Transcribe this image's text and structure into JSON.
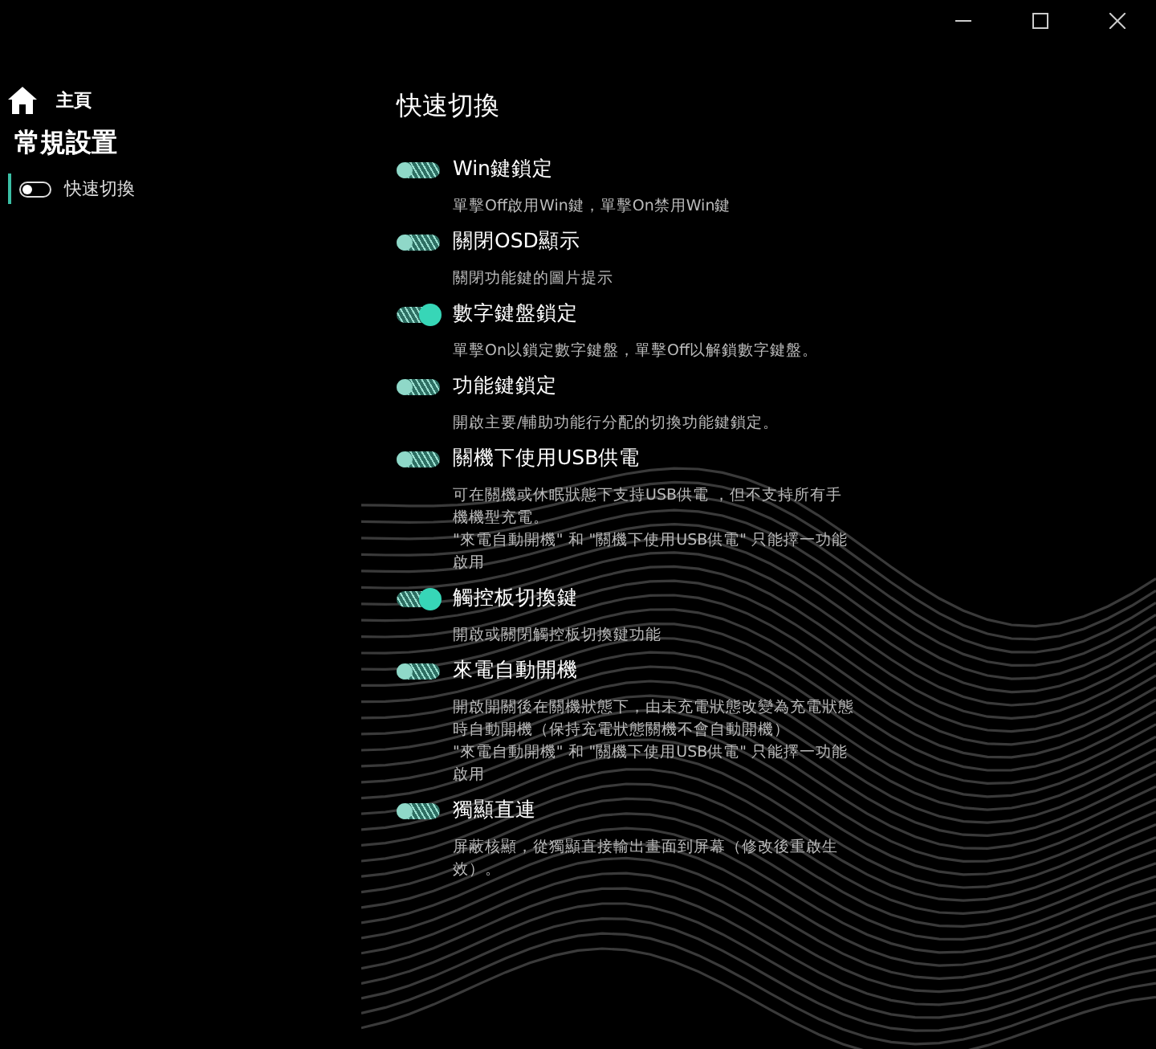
{
  "sidebar": {
    "home": "主頁",
    "section": "常規設置",
    "items": [
      {
        "label": "快速切換",
        "selected": true
      }
    ]
  },
  "page": {
    "title": "快速切換",
    "settings": [
      {
        "title": "Win鍵鎖定",
        "on": false,
        "description": [
          "單擊Off啟用Win鍵，單擊On禁用Win鍵"
        ]
      },
      {
        "title": "關閉OSD顯示",
        "on": false,
        "description": [
          "關閉功能鍵的圖片提示"
        ]
      },
      {
        "title": "數字鍵盤鎖定",
        "on": true,
        "description": [
          "單擊On以鎖定數字鍵盤，單擊Off以解鎖數字鍵盤。"
        ]
      },
      {
        "title": "功能鍵鎖定",
        "on": false,
        "description": [
          "開啟主要/輔助功能行分配的切換功能鍵鎖定。"
        ]
      },
      {
        "title": "關機下使用USB供電",
        "on": false,
        "description": [
          "可在關機或休眠狀態下支持USB供電 ，但不支持所有手機機型充電。",
          "\"來電自動開機\" 和 \"關機下使用USB供電\" 只能擇一功能啟用"
        ]
      },
      {
        "title": "觸控板切換鍵",
        "on": true,
        "description": [
          "開啟或關閉觸控板切換鍵功能"
        ]
      },
      {
        "title": "來電自動開機",
        "on": false,
        "description": [
          "開啟開關後在關機狀態下，由未充電狀態改變為充電狀態時自動開機（保持充電狀態關機不會自動開機）",
          "\"來電自動開機\" 和 \"關機下使用USB供電\" 只能擇一功能啟用"
        ]
      },
      {
        "title": "獨顯直連",
        "on": false,
        "description": [
          "屏蔽核顯，從獨顯直接輸出畫面到屏幕（修改後重啟生效）。"
        ]
      }
    ]
  }
}
